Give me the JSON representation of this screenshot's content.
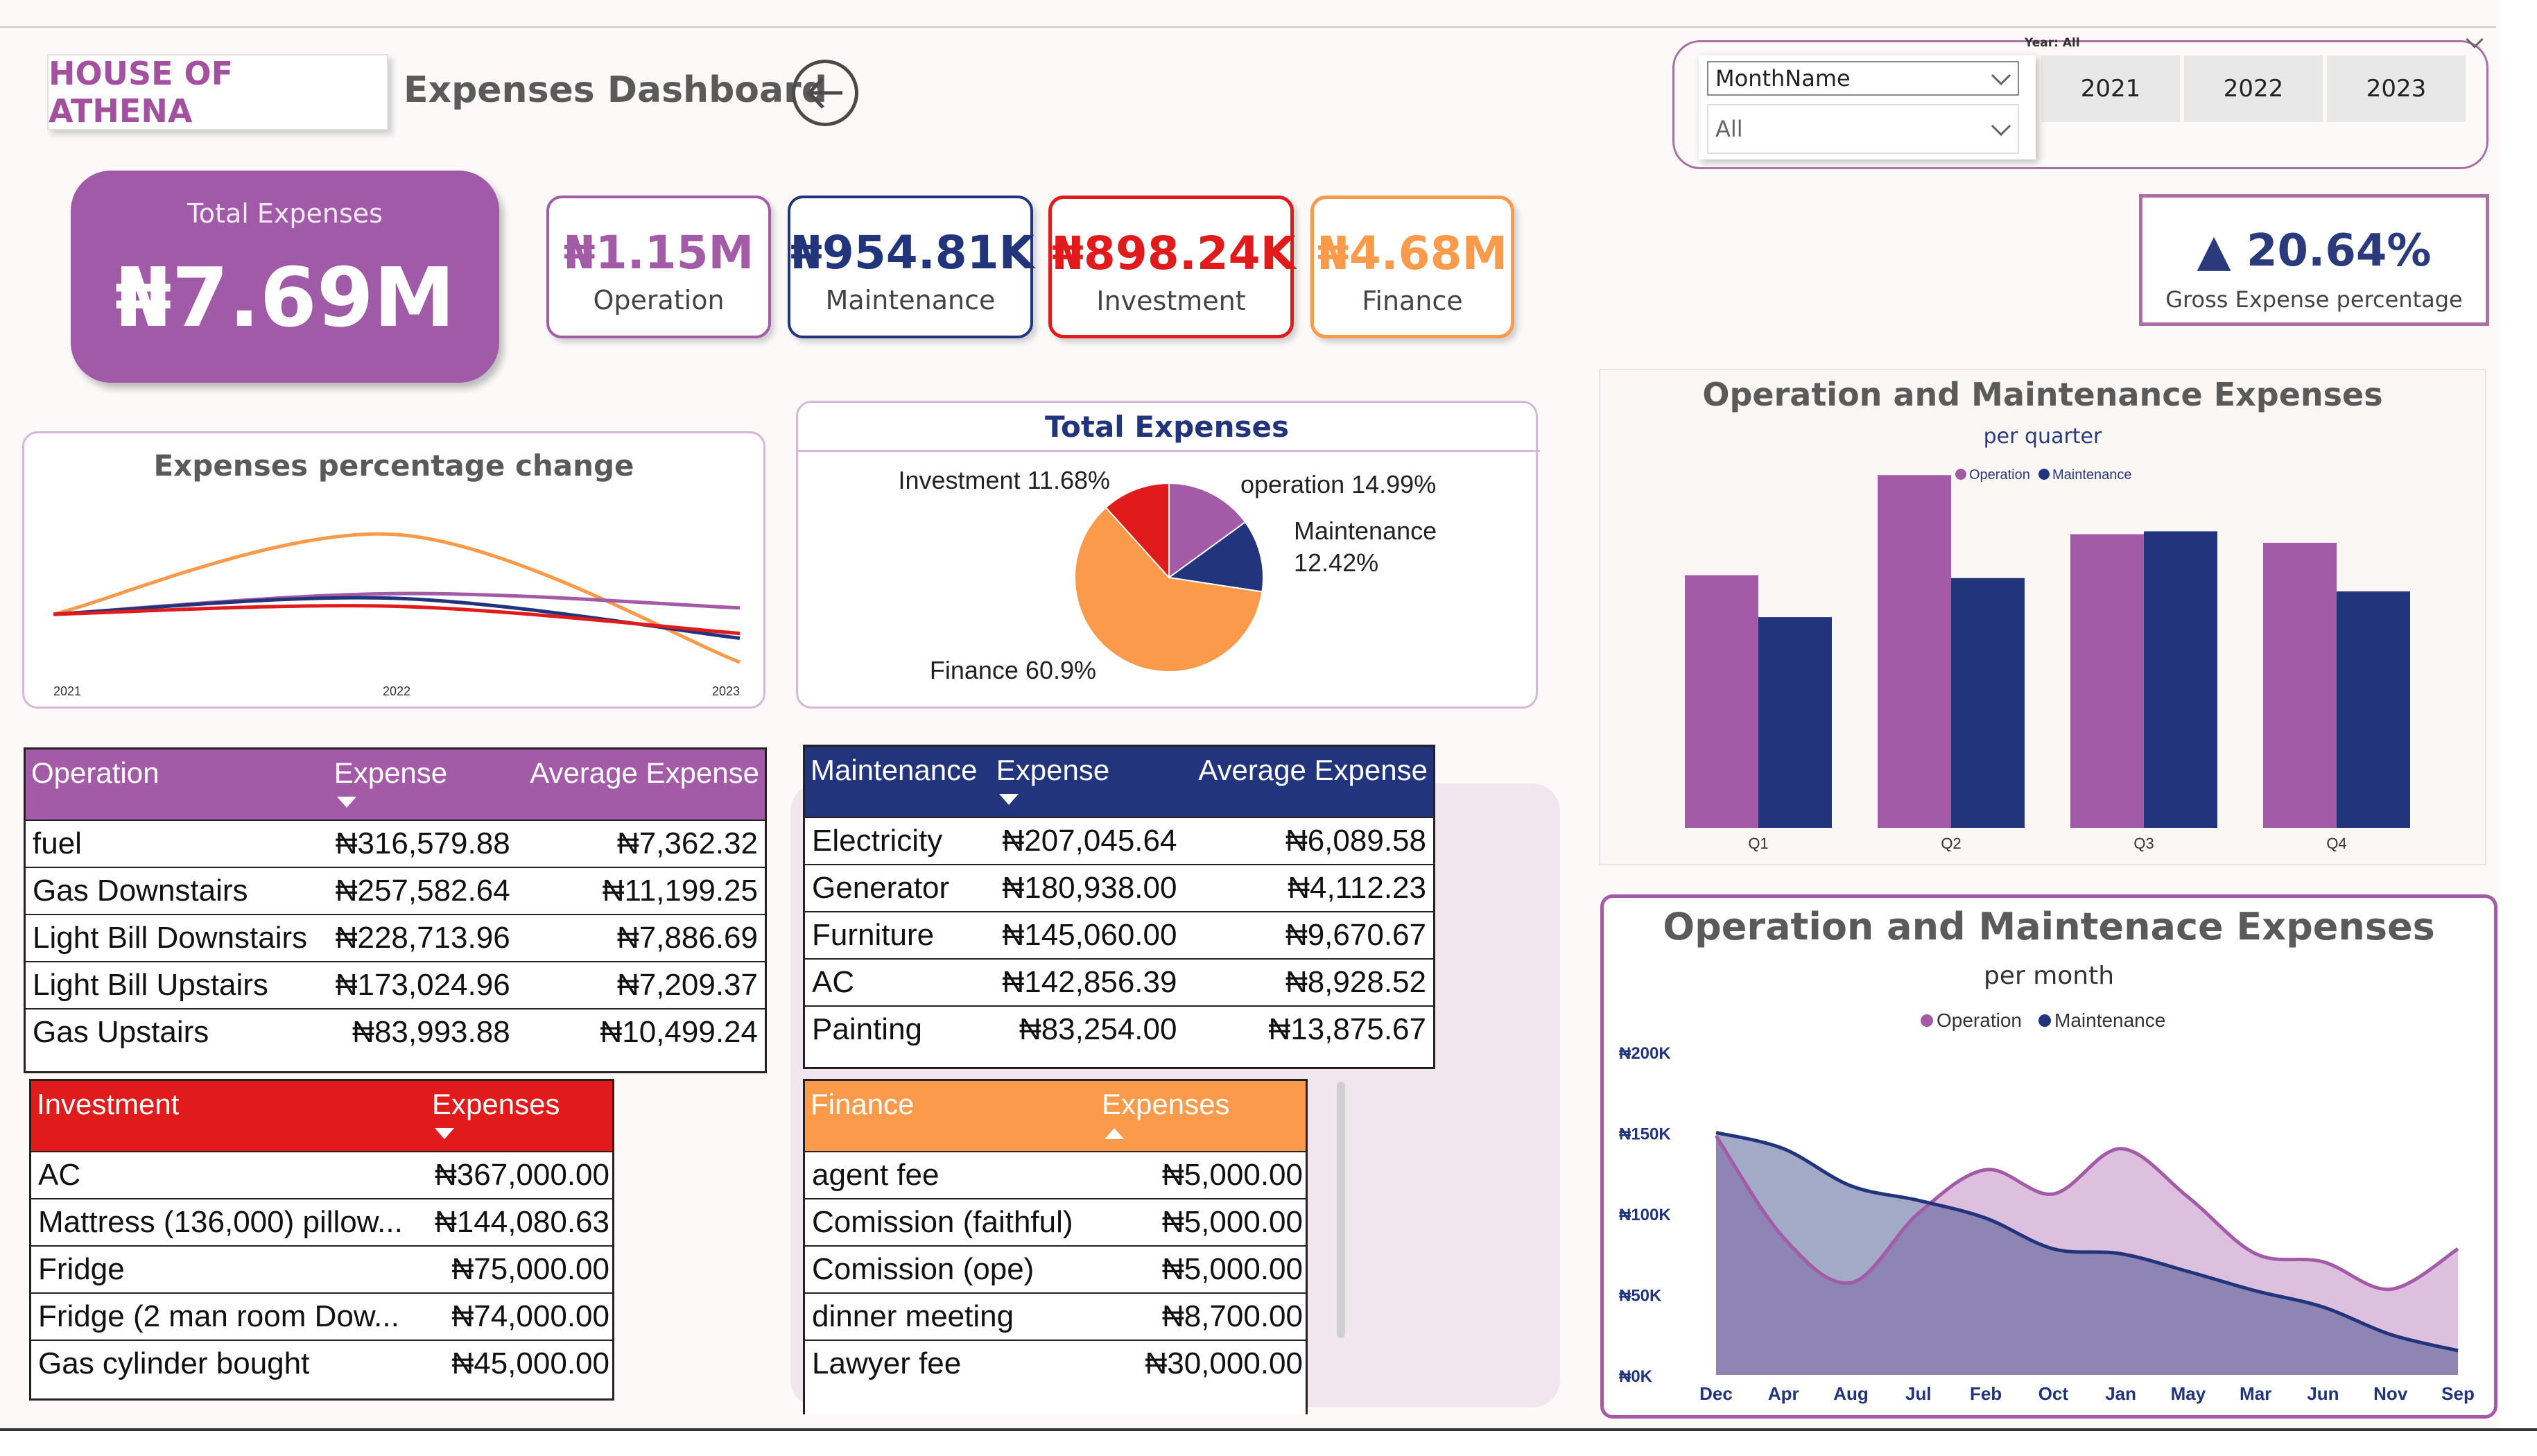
{
  "header": {
    "brand": "HOUSE OF ATHENA",
    "title": "Expenses Dashboard",
    "back_icon": "arrow-left-circle-icon"
  },
  "filters": {
    "year_label": "Year: All",
    "years": [
      "2021",
      "2022",
      "2023"
    ],
    "month_field": "MonthName",
    "month_value": "All"
  },
  "kpis": {
    "total": {
      "label": "Total Expenses",
      "value": "₦7.69M"
    },
    "cards": [
      {
        "value": "₦1.15M",
        "label": "Operation",
        "color": "#a35aa7"
      },
      {
        "value": "₦954.81K",
        "label": "Maintenance",
        "color": "#22347c"
      },
      {
        "value": "₦898.24K",
        "label": "Investment",
        "color": "#e11b1b"
      },
      {
        "value": "₦4.68M",
        "label": "Finance",
        "color": "#fb9a4a"
      }
    ],
    "gross": {
      "value": "20.64%",
      "label": "Gross Expense percentage",
      "icon": "triangle-up-icon"
    }
  },
  "colors": {
    "operation": "#a35aa7",
    "maintenance": "#22347c",
    "investment": "#e11b1b",
    "finance": "#fb9a4a"
  },
  "tables": {
    "operation": {
      "headers": [
        "Operation",
        "Expense",
        "Average Expense"
      ],
      "rows": [
        [
          "fuel",
          "₦316,579.88",
          "₦7,362.32"
        ],
        [
          "Gas Downstairs",
          "₦257,582.64",
          "₦11,199.25"
        ],
        [
          "Light Bill Downstairs",
          "₦228,713.96",
          "₦7,886.69"
        ],
        [
          "Light Bill Upstairs",
          "₦173,024.96",
          "₦7,209.37"
        ],
        [
          "Gas Upstairs",
          "₦83,993.88",
          "₦10,499.24"
        ]
      ]
    },
    "maintenance": {
      "headers": [
        "Maintenance",
        "Expense",
        "Average Expense"
      ],
      "rows": [
        [
          "Electricity",
          "₦207,045.64",
          "₦6,089.58"
        ],
        [
          "Generator",
          "₦180,938.00",
          "₦4,112.23"
        ],
        [
          "Furniture",
          "₦145,060.00",
          "₦9,670.67"
        ],
        [
          "AC",
          "₦142,856.39",
          "₦8,928.52"
        ],
        [
          "Painting",
          "₦83,254.00",
          "₦13,875.67"
        ]
      ]
    },
    "investment": {
      "headers": [
        "Investment",
        "Expenses"
      ],
      "rows": [
        [
          "AC",
          "₦367,000.00"
        ],
        [
          "Mattress (136,000) pillow...",
          "₦144,080.63"
        ],
        [
          "Fridge",
          "₦75,000.00"
        ],
        [
          "Fridge (2 man room Dow...",
          "₦74,000.00"
        ],
        [
          "Gas cylinder bought",
          "₦45,000.00"
        ]
      ]
    },
    "finance": {
      "headers": [
        "Finance",
        "Expenses"
      ],
      "rows": [
        [
          "agent fee",
          "₦5,000.00"
        ],
        [
          "Comission (faithful)",
          "₦5,000.00"
        ],
        [
          "Comission (ope)",
          "₦5,000.00"
        ],
        [
          "dinner meeting",
          "₦8,700.00"
        ],
        [
          "Lawyer fee",
          "₦30,000.00"
        ]
      ]
    }
  },
  "chart_data": [
    {
      "id": "pct-change",
      "type": "line",
      "title": "Expenses percentage change",
      "x": [
        "2021",
        "2022",
        "2023"
      ],
      "ylim": [
        0,
        100
      ],
      "series": [
        {
          "color": "#fb9a4a",
          "values": [
            30,
            80,
            0
          ]
        },
        {
          "color": "#a35aa7",
          "values": [
            30,
            43,
            34
          ]
        },
        {
          "color": "#22347c",
          "values": [
            30,
            40,
            15
          ]
        },
        {
          "color": "#e11b1b",
          "values": [
            30,
            35,
            18
          ]
        }
      ]
    },
    {
      "id": "total-pie",
      "type": "pie",
      "title": "Total Expenses",
      "slices": [
        {
          "label": "operation 14.99%",
          "value": 14.99,
          "color": "#a35aa7"
        },
        {
          "label": "Maintenance 12.42%",
          "value": 12.42,
          "color": "#22347c"
        },
        {
          "label": "Finance 60.9%",
          "value": 60.9,
          "color": "#fb9a4a"
        },
        {
          "label": "Investment 11.68%",
          "value": 11.68,
          "color": "#e11b1b"
        }
      ]
    },
    {
      "id": "quarter-bars",
      "type": "bar",
      "title": "Operation and Maintenance Expenses",
      "subtitle": "per quarter",
      "categories": [
        "Q1",
        "Q2",
        "Q3",
        "Q4"
      ],
      "ylim": [
        0,
        400
      ],
      "series": [
        {
          "name": "Operation",
          "color": "#a35aa7",
          "values": [
            265,
            370,
            308,
            299
          ]
        },
        {
          "name": "Maintenance",
          "color": "#22347c",
          "values": [
            221,
            262,
            311,
            248
          ]
        }
      ]
    },
    {
      "id": "month-area",
      "type": "area",
      "title": "Operation and Maintenace Expenses",
      "subtitle": "per month",
      "categories": [
        "Dec",
        "Apr",
        "Aug",
        "Jul",
        "Feb",
        "Oct",
        "Jan",
        "May",
        "Mar",
        "Jun",
        "Nov",
        "Sep"
      ],
      "y_ticks": [
        "₦0K",
        "₦50K",
        "₦100K",
        "₦150K",
        "₦200K"
      ],
      "ylim": [
        0,
        200000
      ],
      "series": [
        {
          "name": "Operation",
          "color": "#a35aa7",
          "values": [
            148000,
            85000,
            57000,
            100000,
            127000,
            112000,
            140000,
            110000,
            75000,
            70000,
            53000,
            78000
          ]
        },
        {
          "name": "Maintenance",
          "color": "#22347c",
          "values": [
            150000,
            140000,
            117000,
            108000,
            97000,
            78000,
            75000,
            64000,
            52000,
            42000,
            25000,
            15000
          ]
        }
      ]
    }
  ]
}
